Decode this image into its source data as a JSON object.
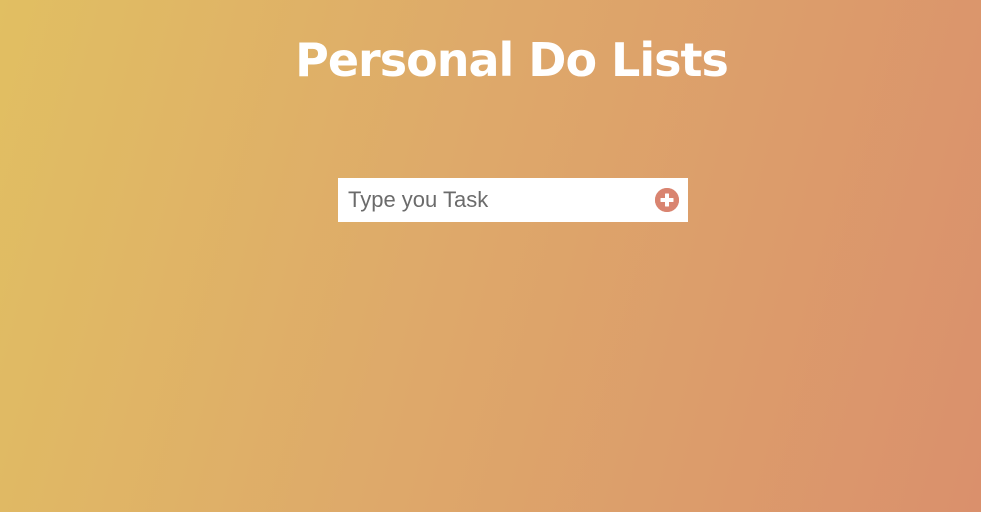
{
  "header": {
    "title": "Personal Do Lists"
  },
  "task_form": {
    "placeholder": "Type you Task",
    "value": "",
    "add_icon": "plus-circle-icon"
  },
  "colors": {
    "gradient_start": "#e1bf62",
    "gradient_end": "#da906c",
    "accent": "#d98470",
    "title_text": "#ffffff"
  }
}
